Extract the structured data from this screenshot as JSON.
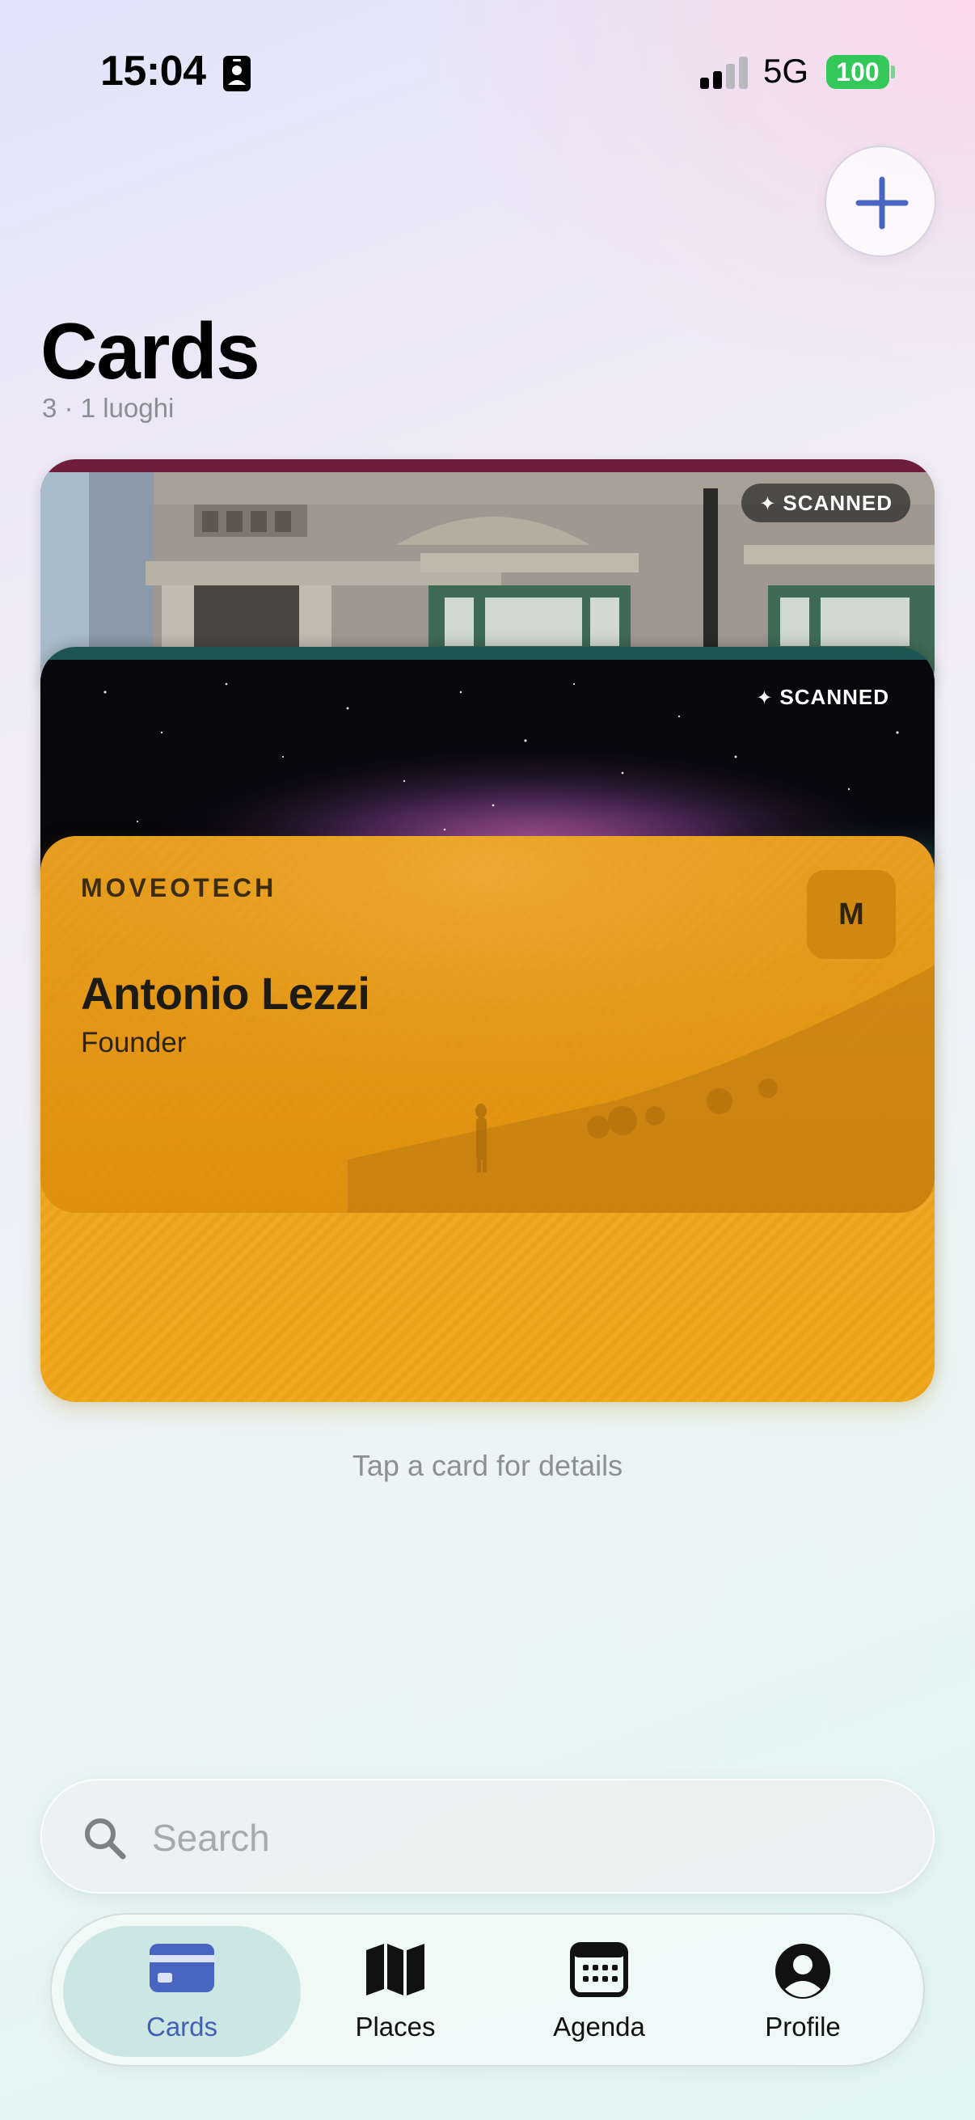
{
  "status_bar": {
    "time": "15:04",
    "network": "5G",
    "battery": "100"
  },
  "header": {
    "title": "Cards",
    "subtitle": "3 · 1 luoghi",
    "add_icon": "plus-icon"
  },
  "cards": [
    {
      "badge": "SCANNED",
      "image": "building-facade-photo"
    },
    {
      "badge": "SCANNED",
      "image": "night-sky-milky-way-photo"
    },
    {
      "company": "MOVEOTECH",
      "monogram": "M",
      "name": "Antonio Lezzi",
      "role": "Founder",
      "color": "#f0a517"
    }
  ],
  "hint": "Tap a card for details",
  "search": {
    "placeholder": "Search",
    "value": ""
  },
  "tabs": [
    {
      "label": "Cards",
      "icon": "card-icon",
      "active": true
    },
    {
      "label": "Places",
      "icon": "map-icon",
      "active": false
    },
    {
      "label": "Agenda",
      "icon": "calendar-icon",
      "active": false
    },
    {
      "label": "Profile",
      "icon": "person-circle-icon",
      "active": false
    }
  ],
  "colors": {
    "accent": "#3f60b5",
    "battery": "#34c759",
    "card_orange": "#f0a517"
  }
}
